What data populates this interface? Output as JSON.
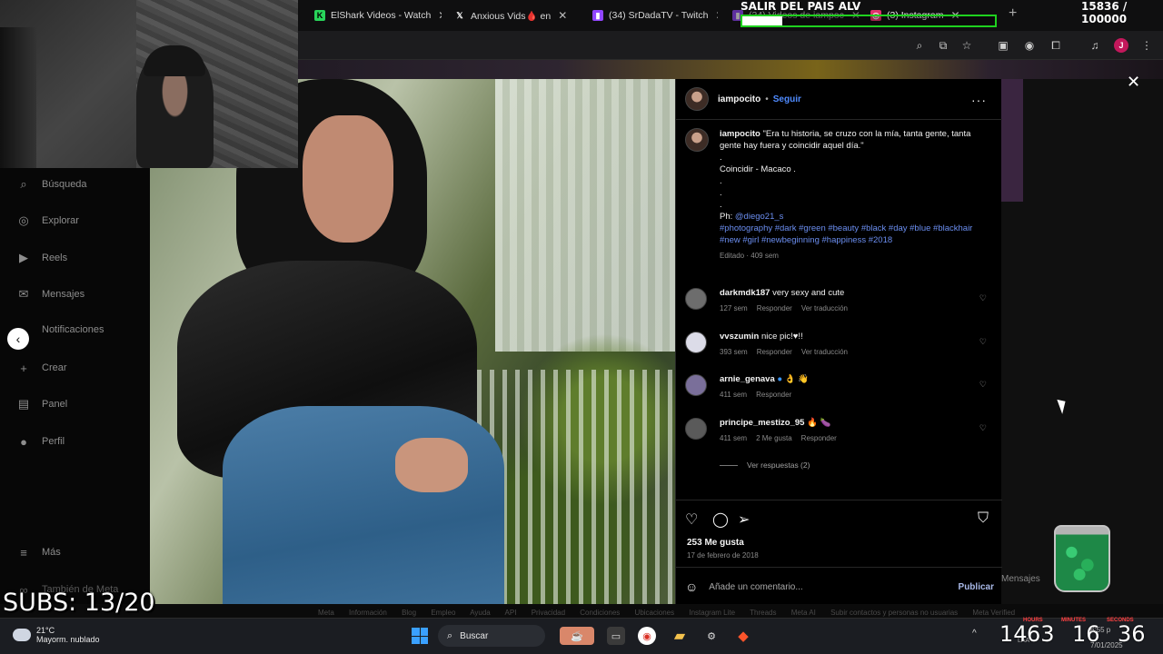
{
  "browser": {
    "tabs": [
      {
        "label": "ElShark Videos - Watch",
        "favicon": "k-logo-icon",
        "color": "#28d45a"
      },
      {
        "label": "Anxious Vids🩸 en",
        "favicon": "x-logo-icon",
        "color": "#ffffff"
      },
      {
        "label": "(34) SrDadaTV - Twitch",
        "favicon": "twitch-icon",
        "color": "#9146ff"
      },
      {
        "label": "(34) Videos de iampoc",
        "favicon": "twitch-icon",
        "color": "#9146ff"
      },
      {
        "label": "(3) Instagram",
        "favicon": "instagram-icon",
        "color": "#e1306c"
      }
    ],
    "new_tab": "+",
    "profile_initial": "J"
  },
  "stream_overlay": {
    "title": "SALIR DEL PAIS ALV",
    "goal_count": "15836  / 100000",
    "goal_progress": 0.158,
    "subs": "SUBS: 13/20"
  },
  "sidebar": {
    "items": [
      {
        "label": "Búsqueda",
        "icon": "search-icon"
      },
      {
        "label": "Explorar",
        "icon": "compass-icon"
      },
      {
        "label": "Reels",
        "icon": "reels-icon"
      },
      {
        "label": "Mensajes",
        "icon": "messenger-icon"
      },
      {
        "label": "Notificaciones",
        "icon": "heart-icon"
      },
      {
        "label": "Crear",
        "icon": "plus-icon"
      },
      {
        "label": "Panel",
        "icon": "dashboard-icon"
      },
      {
        "label": "Perfil",
        "icon": "profile-icon"
      }
    ],
    "more": "Más",
    "meta": "También de Meta"
  },
  "post": {
    "author": "iampocito",
    "separator": "•",
    "follow": "Seguir",
    "caption_author": "iampocito",
    "caption_text": "\"Era tu historia, se cruzo con la mía, tanta gente, tanta gente hay fuera y coincidir aquel día.\"",
    "caption_lines": [
      ".",
      "Coincidir - Macaco .",
      ".",
      ".",
      "."
    ],
    "ph_prefix": "Ph:",
    "ph_user": "@diego21_s",
    "hashtags": "#photography #dark #green #beauty #black #day #blue #blackhair #new #girl #newbeginning #happiness #2018",
    "edited": "Editado · 409 sem",
    "comments": [
      {
        "user": "darkmdk187",
        "text": "very sexy and cute",
        "time": "127 sem",
        "actions": [
          "Responder",
          "Ver traducción"
        ]
      },
      {
        "user": "vvszumin",
        "text": "nice pic!♥!!",
        "time": "393 sem",
        "actions": [
          "Responder",
          "Ver traducción"
        ]
      },
      {
        "user": "arnie_genava",
        "text": "👌 👋",
        "time": "411 sem",
        "actions": [
          "Responder"
        ]
      },
      {
        "user": "principe_mestizo_95",
        "text": "🔥 🍆",
        "time": "411 sem",
        "actions": [
          "2 Me gusta",
          "Responder"
        ]
      }
    ],
    "view_replies": "Ver respuestas (2)",
    "likes": "253 Me gusta",
    "date": "17 de febrero de 2018",
    "comment_placeholder": "Añade un comentario...",
    "publish": "Publicar"
  },
  "background": {
    "mensajes": "Mensajes",
    "footer_links": [
      "Meta",
      "Información",
      "Blog",
      "Empleo",
      "Ayuda",
      "API",
      "Privacidad",
      "Condiciones",
      "Ubicaciones",
      "Instagram Lite",
      "Threads",
      "Meta AI",
      "Subir contactos y personas no usuarias",
      "Meta Verified"
    ]
  },
  "taskbar": {
    "temperature": "21°C",
    "weather": "Mayorm. nublado",
    "search": "Buscar",
    "clock_time": "6:55 p",
    "clock_date": "7/01/2025",
    "hours": "14",
    "minutes_a": "63",
    "minutes_b": "16",
    "seconds": "36",
    "label_hours": "HOURS",
    "label_minutes": "MINUTES",
    "label_seconds": "SECONDS",
    "lang": "LAA"
  }
}
